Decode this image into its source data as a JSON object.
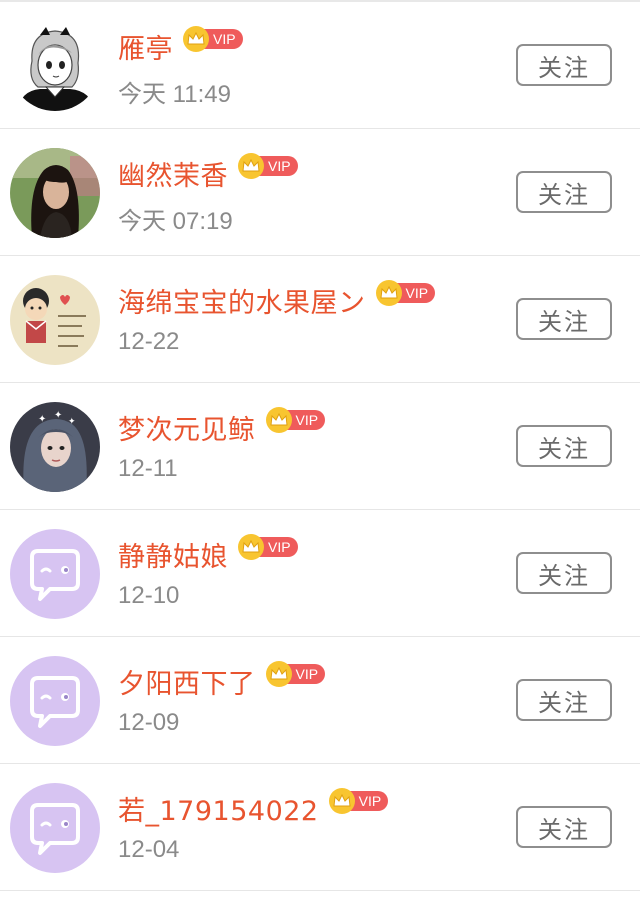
{
  "colors": {
    "name": "#e8542f",
    "vip_badge": "#ef5b5b",
    "crown": "#f8c530",
    "time": "#8a8a8a",
    "button_border": "#8e8e8e",
    "default_avatar_bg": "#d7c4f2"
  },
  "users": [
    {
      "name": "雁亭",
      "badge": "VIP",
      "time": "今天 11:49",
      "follow_label": "关注",
      "avatar": "manga-girl-avatar"
    },
    {
      "name": "幽然茉香",
      "badge": "VIP",
      "time": "今天 07:19",
      "follow_label": "关注",
      "avatar": "photo-avatar"
    },
    {
      "name": "海绵宝宝的水果屋ン",
      "badge": "VIP",
      "time": "12-22",
      "follow_label": "关注",
      "avatar": "cartoon-avatar"
    },
    {
      "name": "梦次元见鲸",
      "badge": "VIP",
      "time": "12-11",
      "follow_label": "关注",
      "avatar": "photo-avatar"
    },
    {
      "name": "静静姑娘",
      "badge": "VIP",
      "time": "12-10",
      "follow_label": "关注",
      "avatar": "default-chat-avatar"
    },
    {
      "name": "夕阳西下了",
      "badge": "VIP",
      "time": "12-09",
      "follow_label": "关注",
      "avatar": "default-chat-avatar"
    },
    {
      "name": "若_179154022",
      "badge": "VIP",
      "time": "12-04",
      "follow_label": "关注",
      "avatar": "default-chat-avatar"
    }
  ]
}
